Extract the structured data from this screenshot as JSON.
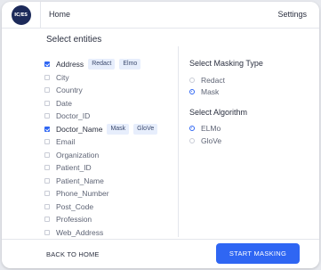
{
  "header": {
    "logo_text": "IC/ES",
    "home_label": "Home",
    "settings_label": "Settings"
  },
  "section_title": "Select entities",
  "entities": [
    {
      "label": "Address",
      "checked": true,
      "tags": [
        "Redact",
        "Elmo"
      ]
    },
    {
      "label": "City",
      "checked": false,
      "tags": []
    },
    {
      "label": "Country",
      "checked": false,
      "tags": []
    },
    {
      "label": "Date",
      "checked": false,
      "tags": []
    },
    {
      "label": "Doctor_ID",
      "checked": false,
      "tags": []
    },
    {
      "label": "Doctor_Name",
      "checked": true,
      "tags": [
        "Mask",
        "GloVe"
      ]
    },
    {
      "label": "Email",
      "checked": false,
      "tags": []
    },
    {
      "label": "Organization",
      "checked": false,
      "tags": []
    },
    {
      "label": "Patient_ID",
      "checked": false,
      "tags": []
    },
    {
      "label": "Patient_Name",
      "checked": false,
      "tags": []
    },
    {
      "label": "Phone_Number",
      "checked": false,
      "tags": []
    },
    {
      "label": "Post_Code",
      "checked": false,
      "tags": []
    },
    {
      "label": "Profession",
      "checked": false,
      "tags": []
    },
    {
      "label": "Web_Address",
      "checked": false,
      "tags": []
    }
  ],
  "masking": {
    "title": "Select Masking Type",
    "options": [
      {
        "label": "Redact",
        "selected": false
      },
      {
        "label": "Mask",
        "selected": true
      }
    ]
  },
  "algorithm": {
    "title": "Select Algorithm",
    "options": [
      {
        "label": "ELMo",
        "selected": true
      },
      {
        "label": "GloVe",
        "selected": false
      }
    ]
  },
  "footer": {
    "back_label": "BACK TO HOME",
    "start_label": "START MASKING"
  },
  "colors": {
    "accent": "#2f66f3",
    "tag_bg": "#e7eefc",
    "logo_bg": "#1c2a5a"
  }
}
